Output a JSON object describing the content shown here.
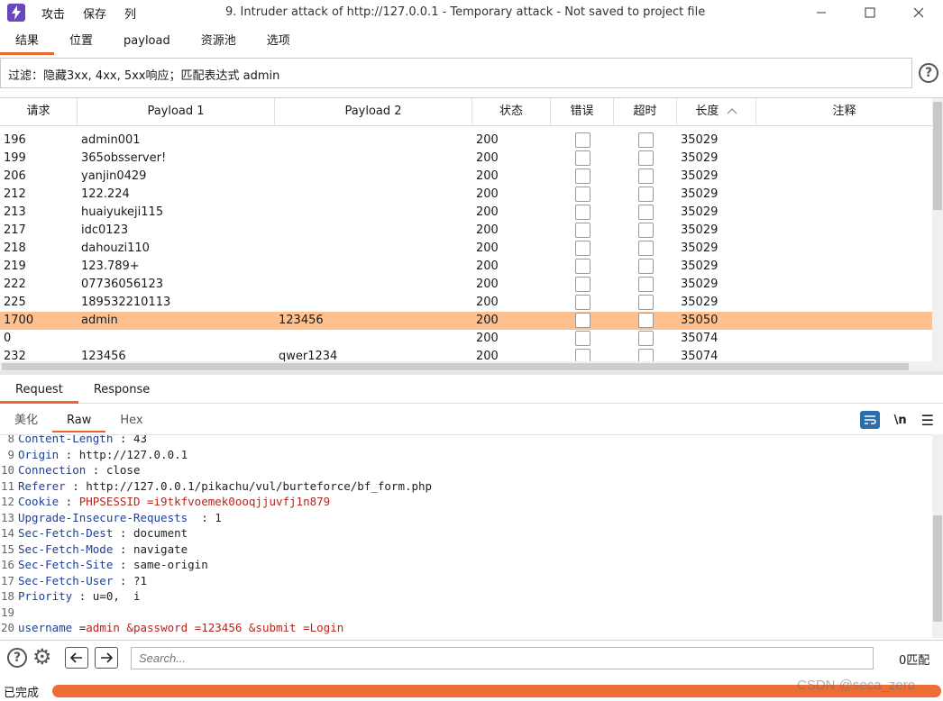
{
  "menu": [
    "攻击",
    "保存",
    "列"
  ],
  "window_title": "9. Intruder attack of http://127.0.0.1 - Temporary attack - Not saved to project file",
  "top_tabs": [
    "结果",
    "位置",
    "payload",
    "资源池",
    "选项"
  ],
  "filter_text": "过滤：隐藏3xx, 4xx, 5xx响应；匹配表达式 admin",
  "columns": [
    "请求",
    "Payload 1",
    "Payload 2",
    "状态",
    "错误",
    "超时",
    "长度",
    "注释"
  ],
  "rows": [
    {
      "req": "196",
      "p1": "admin001",
      "p2": "",
      "status": "200",
      "length": "35029"
    },
    {
      "req": "199",
      "p1": "365obsserver!",
      "p2": "",
      "status": "200",
      "length": "35029"
    },
    {
      "req": "206",
      "p1": "yanjin0429",
      "p2": "",
      "status": "200",
      "length": "35029"
    },
    {
      "req": "212",
      "p1": "122.224",
      "p2": "",
      "status": "200",
      "length": "35029"
    },
    {
      "req": "213",
      "p1": "huaiyukeji115",
      "p2": "",
      "status": "200",
      "length": "35029"
    },
    {
      "req": "217",
      "p1": "idc0123",
      "p2": "",
      "status": "200",
      "length": "35029"
    },
    {
      "req": "218",
      "p1": "dahouzi110",
      "p2": "",
      "status": "200",
      "length": "35029"
    },
    {
      "req": "219",
      "p1": "123.789+",
      "p2": "",
      "status": "200",
      "length": "35029"
    },
    {
      "req": "222",
      "p1": "07736056123",
      "p2": "",
      "status": "200",
      "length": "35029"
    },
    {
      "req": "225",
      "p1": "189532210113",
      "p2": "",
      "status": "200",
      "length": "35029"
    },
    {
      "req": "1700",
      "p1": "admin",
      "p2": "123456",
      "status": "200",
      "length": "35050",
      "selected": true
    },
    {
      "req": "0",
      "p1": "",
      "p2": "",
      "status": "200",
      "length": "35074"
    },
    {
      "req": "232",
      "p1": "123456",
      "p2": "qwer1234",
      "status": "200",
      "length": "35074"
    }
  ],
  "rr_tabs": [
    "Request",
    "Response"
  ],
  "sub_tabs": [
    "美化",
    "Raw",
    "Hex"
  ],
  "newline_label": "\\n",
  "request_lines": [
    {
      "n": "8",
      "key": "Content-Length",
      "sep": " : ",
      "val": "43",
      "red": false
    },
    {
      "n": "9",
      "key": "Origin",
      "sep": " : ",
      "val": "http://127.0.0.1",
      "red": false
    },
    {
      "n": "10",
      "key": "Connection",
      "sep": " : ",
      "val": "close",
      "red": false
    },
    {
      "n": "11",
      "key": "Referer",
      "sep": " : ",
      "val": "http://127.0.0.1/pikachu/vul/burteforce/bf_form.php",
      "red": false
    },
    {
      "n": "12",
      "key": "Cookie",
      "sep": " : ",
      "val": "PHPSESSID =i9tkfvoemek0ooqjjuvfj1n879",
      "red": true
    },
    {
      "n": "13",
      "key": "Upgrade-Insecure-Requests",
      "sep": "  : ",
      "val": "1",
      "red": false
    },
    {
      "n": "14",
      "key": "Sec-Fetch-Dest",
      "sep": " : ",
      "val": "document",
      "red": false
    },
    {
      "n": "15",
      "key": "Sec-Fetch-Mode",
      "sep": " : ",
      "val": "navigate",
      "red": false
    },
    {
      "n": "16",
      "key": "Sec-Fetch-Site",
      "sep": " : ",
      "val": "same-origin",
      "red": false
    },
    {
      "n": "17",
      "key": "Sec-Fetch-User",
      "sep": " : ",
      "val": "?1",
      "red": false
    },
    {
      "n": "18",
      "key": "Priority",
      "sep": " : ",
      "val": "u=0,  i",
      "red": false
    },
    {
      "n": "19",
      "key": "",
      "sep": "",
      "val": "",
      "red": false
    },
    {
      "n": "20",
      "key": "username",
      "sep": " =",
      "val": "admin &password =123456 &submit =Login",
      "red": true
    }
  ],
  "search": {
    "placeholder": "Search..."
  },
  "matches": "0匹配",
  "status_text": "已完成",
  "watermark": "CSDN @seca_zero",
  "colors": {
    "accent": "#e8672e",
    "selected_row": "#fdc08e",
    "progress": "#ee6c36",
    "logo": "#6b46c1"
  }
}
